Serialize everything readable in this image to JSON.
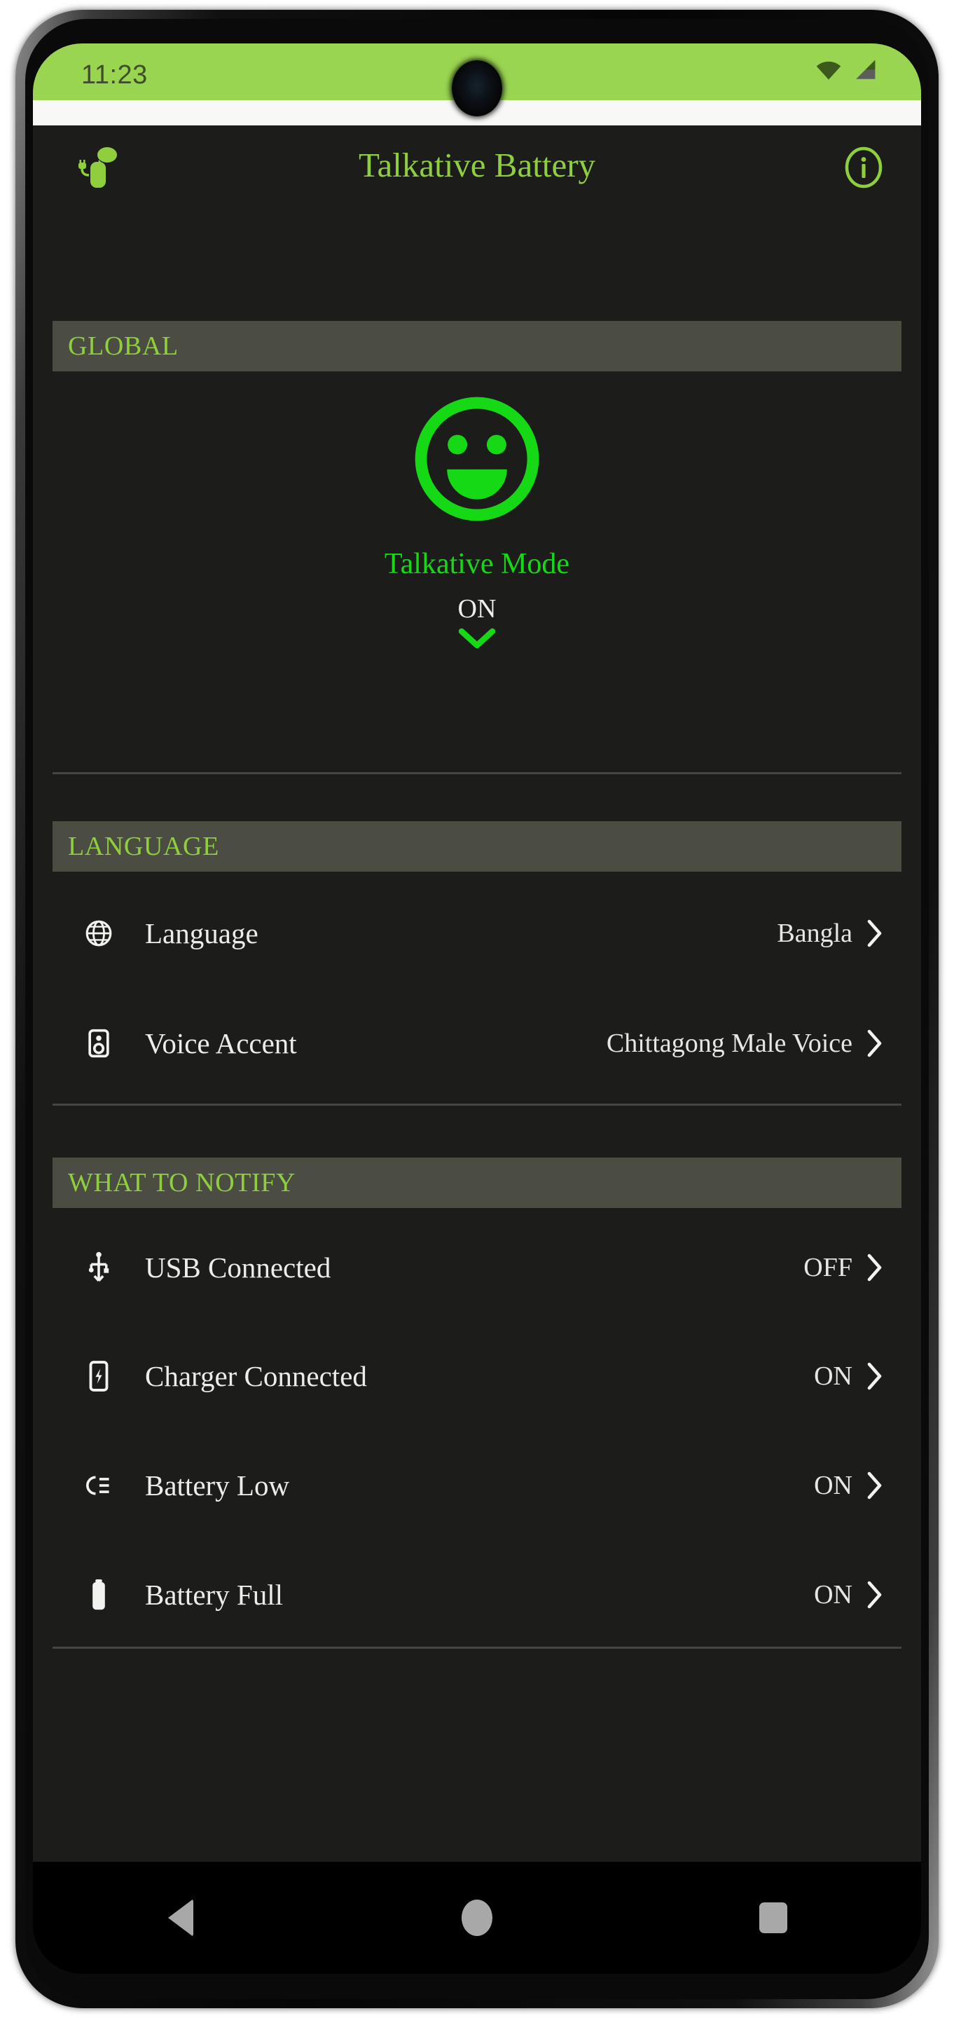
{
  "status_bar": {
    "time": "11:23",
    "wifi_icon": "wifi-icon",
    "signal_icon": "cellular-signal-icon",
    "bar_color": "#9ad551"
  },
  "app_bar": {
    "logo_icon": "talking-battery-logo-icon",
    "title": "Talkative Battery",
    "info_icon": "info-circle-icon",
    "accent_color": "#8fcf3e"
  },
  "sections": [
    {
      "header": "GLOBAL",
      "global": {
        "face_icon": "smiley-face-icon",
        "mode_label": "Talkative Mode",
        "mode_state": "ON",
        "chevron_icon": "chevron-down-icon",
        "face_color": "#16d916"
      }
    },
    {
      "header": "LANGUAGE",
      "rows": [
        {
          "icon": "globe-icon",
          "label": "Language",
          "value": "Bangla",
          "chevron": "chevron-right-icon"
        },
        {
          "icon": "speaker-icon",
          "label": "Voice Accent",
          "value": "Chittagong Male Voice",
          "chevron": "chevron-right-icon"
        }
      ]
    },
    {
      "header": "WHAT TO NOTIFY",
      "rows": [
        {
          "icon": "usb-icon",
          "label": "USB Connected",
          "value": "OFF",
          "chevron": "chevron-right-icon"
        },
        {
          "icon": "phone-charging-icon",
          "label": "Charger Connected",
          "value": "ON",
          "chevron": "chevron-right-icon"
        },
        {
          "icon": "battery-low-icon",
          "label": "Battery Low",
          "value": "ON",
          "chevron": "chevron-right-icon"
        },
        {
          "icon": "battery-full-icon",
          "label": "Battery Full",
          "value": "ON",
          "chevron": "chevron-right-icon"
        }
      ]
    }
  ],
  "nav_bar": {
    "back": "back-button",
    "home": "home-button",
    "recents": "recents-button"
  }
}
